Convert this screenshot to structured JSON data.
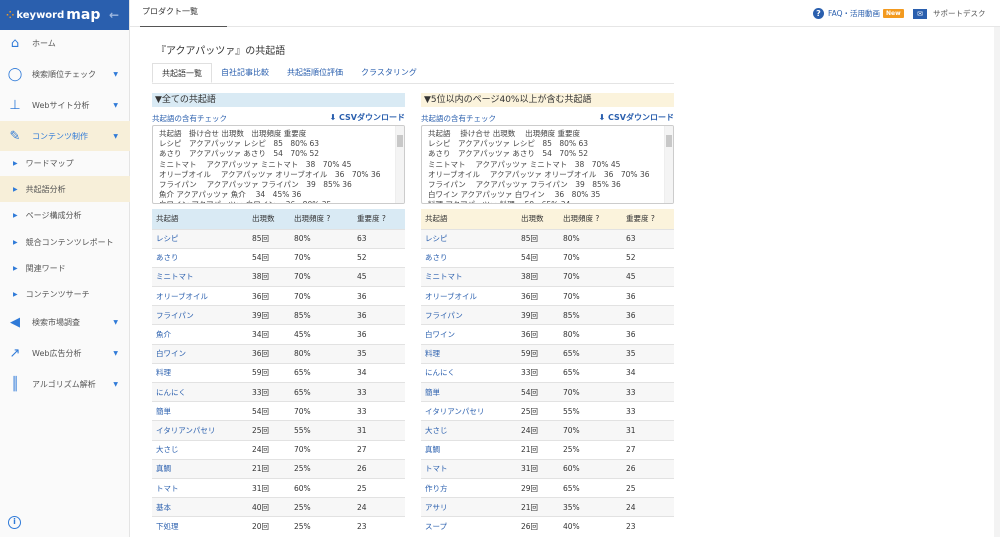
{
  "logo": {
    "small": "keyword",
    "big": "map"
  },
  "sidebar": {
    "items": [
      {
        "label": "ホーム",
        "icon": "home-icon",
        "glyph": "⌂"
      },
      {
        "label": "検索順位チェック",
        "icon": "lightbulb-icon",
        "glyph": "◯"
      },
      {
        "label": "Webサイト分析",
        "icon": "sitemap-icon",
        "glyph": "⊥"
      },
      {
        "label": "コンテンツ制作",
        "icon": "edit-icon",
        "glyph": "✎",
        "active": true
      },
      {
        "label": "検索市場調査",
        "icon": "megaphone-icon",
        "glyph": "◀"
      },
      {
        "label": "Web広告分析",
        "icon": "chart-line-icon",
        "glyph": "↗"
      },
      {
        "label": "アルゴリズム解析",
        "icon": "sliders-icon",
        "glyph": "║"
      }
    ],
    "subitems": [
      {
        "label": "ワードマップ"
      },
      {
        "label": "共起語分析",
        "active": true
      },
      {
        "label": "ページ構成分析"
      },
      {
        "label": "競合コンテンツレポート"
      },
      {
        "label": "関連ワード"
      },
      {
        "label": "コンテンツサーチ"
      }
    ]
  },
  "topbar": {
    "product_tab": "プロダクト一覧",
    "faq": "FAQ・活用動画",
    "new_badge": "New",
    "support": "サポートデスク"
  },
  "page": {
    "title": "『アクアパッツァ』の共起語",
    "tabs": [
      "共起語一覧",
      "自社記事比較",
      "共起語順位評価",
      "クラスタリング"
    ]
  },
  "panels": [
    {
      "title": "▼全ての共起語",
      "header_color": "#d9eaf4",
      "check_link": "共起語の含有チェック",
      "csv": "CSVダウンロード",
      "textarea": "共起語　掛け合せ 出現数　出現頻度 重要度\nレシピ　アクアパッツァ レシピ　85　80% 63\nあさり　アクアパッツァ あさり　54　70% 52\nミニトマト　 アクアパッツァ ミニトマト　38　70% 45\nオリーブオイル　 アクアパッツァ オリーブオイル　36　70% 36\nフライパン　 アクアパッツァ フライパン　39　85% 36\n魚介 アクアパッツァ 魚介　 34　45% 36\n白ワイン アクアパッツァ 白ワイン　 36　80% 35",
      "columns": [
        "共起語",
        "出現数",
        "出現頻度 ?",
        "重要度 ?"
      ],
      "rows": [
        [
          "レシピ",
          "85回",
          "80%",
          "63"
        ],
        [
          "あさり",
          "54回",
          "70%",
          "52"
        ],
        [
          "ミニトマト",
          "38回",
          "70%",
          "45"
        ],
        [
          "オリーブオイル",
          "36回",
          "70%",
          "36"
        ],
        [
          "フライパン",
          "39回",
          "85%",
          "36"
        ],
        [
          "魚介",
          "34回",
          "45%",
          "36"
        ],
        [
          "白ワイン",
          "36回",
          "80%",
          "35"
        ],
        [
          "料理",
          "59回",
          "65%",
          "34"
        ],
        [
          "にんにく",
          "33回",
          "65%",
          "33"
        ],
        [
          "簡単",
          "54回",
          "70%",
          "33"
        ],
        [
          "イタリアンパセリ",
          "25回",
          "55%",
          "31"
        ],
        [
          "大さじ",
          "24回",
          "70%",
          "27"
        ],
        [
          "真鯛",
          "21回",
          "25%",
          "26"
        ],
        [
          "トマト",
          "31回",
          "60%",
          "25"
        ],
        [
          "基本",
          "40回",
          "25%",
          "24"
        ],
        [
          "下処理",
          "20回",
          "25%",
          "23"
        ]
      ]
    },
    {
      "title": "▼5位以内のページ40%以上が含む共起語",
      "header_color": "#fbf3dc",
      "check_link": "共起語の含有チェック",
      "csv": "CSVダウンロード",
      "textarea": "共起語　 掛け合せ 出現数　 出現頻度 重要度\nレシピ　アクアパッツァ レシピ　85　80% 63\nあさり　アクアパッツァ あさり　54　70% 52\nミニトマト　 アクアパッツァ ミニトマト　38　70% 45\nオリーブオイル　 アクアパッツァ オリーブオイル　36　70% 36\nフライパン　 アクアパッツァ フライパン　39　85% 36\n白ワイン アクアパッツァ 白ワイン　 36　80% 35\n料理 アクアパッツァ 料理　 59　65% 34",
      "columns": [
        "共起語",
        "出現数",
        "出現頻度 ?",
        "重要度 ?"
      ],
      "rows": [
        [
          "レシピ",
          "85回",
          "80%",
          "63"
        ],
        [
          "あさり",
          "54回",
          "70%",
          "52"
        ],
        [
          "ミニトマト",
          "38回",
          "70%",
          "45"
        ],
        [
          "オリーブオイル",
          "36回",
          "70%",
          "36"
        ],
        [
          "フライパン",
          "39回",
          "85%",
          "36"
        ],
        [
          "白ワイン",
          "36回",
          "80%",
          "36"
        ],
        [
          "料理",
          "59回",
          "65%",
          "35"
        ],
        [
          "にんにく",
          "33回",
          "65%",
          "34"
        ],
        [
          "簡単",
          "54回",
          "70%",
          "33"
        ],
        [
          "イタリアンパセリ",
          "25回",
          "55%",
          "33"
        ],
        [
          "大さじ",
          "24回",
          "70%",
          "31"
        ],
        [
          "真鯛",
          "21回",
          "25%",
          "27"
        ],
        [
          "トマト",
          "31回",
          "60%",
          "26"
        ],
        [
          "作り方",
          "29回",
          "65%",
          "25"
        ],
        [
          "アサリ",
          "21回",
          "35%",
          "24"
        ],
        [
          "スープ",
          "26回",
          "40%",
          "23"
        ]
      ]
    }
  ]
}
